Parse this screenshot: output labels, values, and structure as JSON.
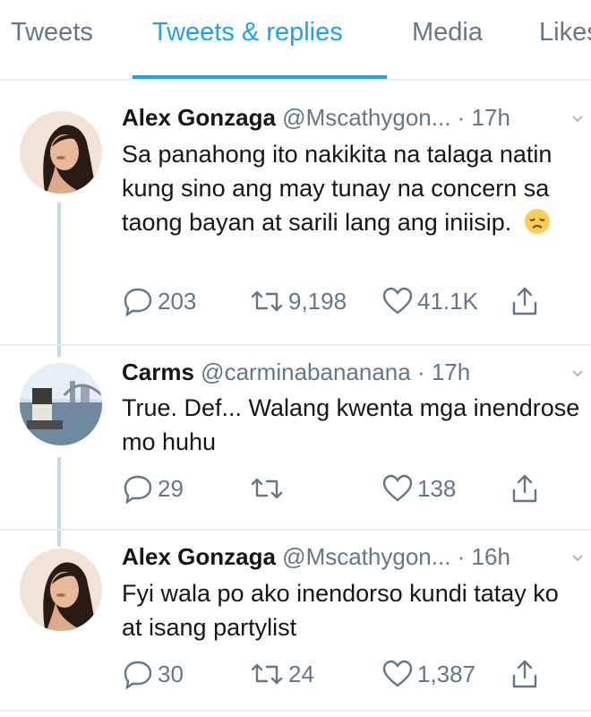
{
  "tabs": [
    {
      "label": "Tweets"
    },
    {
      "label": "Tweets & replies",
      "active": true
    },
    {
      "label": "Media"
    },
    {
      "label": "Likes"
    }
  ],
  "tweets": [
    {
      "name": "Alex Gonzaga",
      "handle": "@Mscathygon...",
      "time": "· 17h",
      "text": "Sa panahong ito nakikita na talaga natin kung sino ang may tunay na concern sa taong bayan at sarili lang ang iniisip.",
      "emoji": "disappointed-face",
      "replies": "203",
      "retweets": "9,198",
      "likes": "41.1K"
    },
    {
      "name": "Carms",
      "handle": "@carminabananana",
      "time": "· 17h",
      "text": "True. Def... Walang kwenta mga inendrose mo huhu",
      "replies": "29",
      "retweets": "",
      "likes": "138"
    },
    {
      "name": "Alex Gonzaga",
      "handle": "@Mscathygon...",
      "time": "· 16h",
      "text": "Fyi wala po ako inendorso kundi tatay ko at isang partylist",
      "replies": "30",
      "retweets": "24",
      "likes": "1,387"
    }
  ],
  "colors": {
    "accent": "#1da1f2",
    "muted": "#657786",
    "text": "#14171a",
    "divider": "#e6ecf0"
  }
}
